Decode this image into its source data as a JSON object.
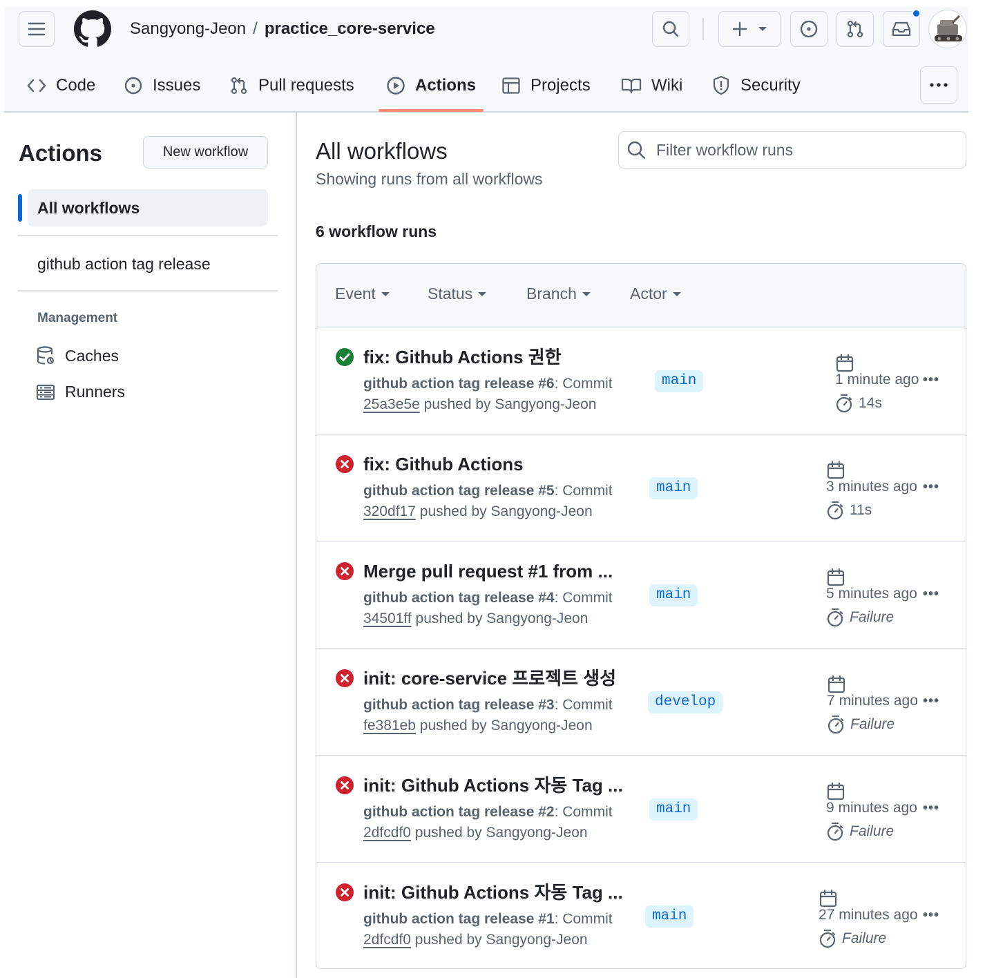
{
  "header": {
    "owner": "Sangyong-Jeon",
    "separator": "/",
    "repo": "practice_core-service"
  },
  "tabs": [
    {
      "label": "Code",
      "icon": "code-icon"
    },
    {
      "label": "Issues",
      "icon": "issue-opened-icon"
    },
    {
      "label": "Pull requests",
      "icon": "git-pull-request-icon"
    },
    {
      "label": "Actions",
      "icon": "play-icon",
      "selected": true
    },
    {
      "label": "Projects",
      "icon": "table-icon"
    },
    {
      "label": "Wiki",
      "icon": "book-icon"
    },
    {
      "label": "Security",
      "icon": "shield-icon"
    }
  ],
  "sidebar": {
    "title": "Actions",
    "new_workflow": "New workflow",
    "all_workflows": "All workflows",
    "workflows": [
      "github action tag release"
    ],
    "management_heading": "Management",
    "management": [
      {
        "label": "Caches",
        "icon": "database-icon"
      },
      {
        "label": "Runners",
        "icon": "server-icon"
      }
    ]
  },
  "main": {
    "title": "All workflows",
    "subtitle": "Showing runs from all workflows",
    "filter_placeholder": "Filter workflow runs",
    "run_count": "6 workflow runs",
    "filters": [
      "Event",
      "Status",
      "Branch",
      "Actor"
    ]
  },
  "runs": [
    {
      "status": "success",
      "title": "fix: Github Actions 권한",
      "workflow": "github action tag release",
      "number": "#6",
      "commit_label": ": Commit",
      "sha": "25a3e5e",
      "pushed_by": "pushed by Sangyong-Jeon",
      "branch": "main",
      "when": "1 minute ago",
      "duration": "14s",
      "failed": false
    },
    {
      "status": "failure",
      "title": "fix: Github Actions",
      "workflow": "github action tag release",
      "number": "#5",
      "commit_label": ": Commit",
      "sha": "320df17",
      "pushed_by": "pushed by Sangyong-Jeon",
      "branch": "main",
      "when": "3 minutes ago",
      "duration": "11s",
      "failed": false
    },
    {
      "status": "failure",
      "title": "Merge pull request #1 from ...",
      "workflow": "github action tag release",
      "number": "#4",
      "commit_label": ": Commit",
      "sha": "34501ff",
      "pushed_by": "pushed by Sangyong-Jeon",
      "branch": "main",
      "when": "5 minutes ago",
      "duration": "Failure",
      "failed": true
    },
    {
      "status": "failure",
      "title": "init: core-service 프로젝트 생성",
      "workflow": "github action tag release",
      "number": "#3",
      "commit_label": ": Commit",
      "sha": "fe381eb",
      "pushed_by": "pushed by Sangyong-Jeon",
      "branch": "develop",
      "when": "7 minutes ago",
      "duration": "Failure",
      "failed": true
    },
    {
      "status": "failure",
      "title": "init: Github Actions 자동 Tag ...",
      "workflow": "github action tag release",
      "number": "#2",
      "commit_label": ": Commit",
      "sha": "2dfcdf0",
      "pushed_by": "pushed by Sangyong-Jeon",
      "branch": "main",
      "when": "9 minutes ago",
      "duration": "Failure",
      "failed": true
    },
    {
      "status": "failure",
      "title": "init: Github Actions 자동 Tag ...",
      "workflow": "github action tag release",
      "number": "#1",
      "commit_label": ": Commit",
      "sha": "2dfcdf0",
      "pushed_by": "pushed by Sangyong-Jeon",
      "branch": "main",
      "when": "27 minutes ago",
      "duration": "Failure",
      "failed": true
    }
  ],
  "colors": {
    "success": "#1a7f37",
    "failure": "#cf222e",
    "accent": "#0969da",
    "tab_underline": "#fd8c73"
  }
}
